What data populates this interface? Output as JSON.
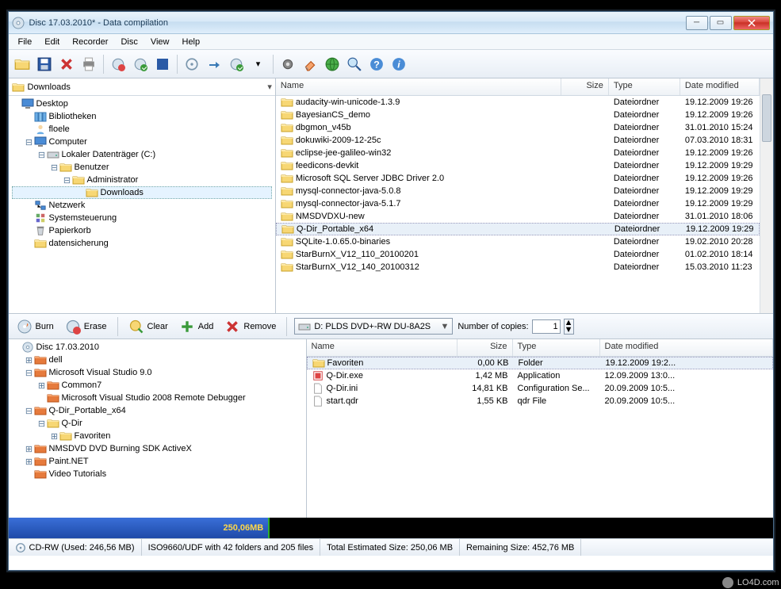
{
  "window": {
    "title": "Disc 17.03.2010* - Data compilation"
  },
  "menu": [
    "File",
    "Edit",
    "Recorder",
    "Disc",
    "View",
    "Help"
  ],
  "breadcrumb": "Downloads",
  "tree_top": [
    {
      "indent": 0,
      "exp": "",
      "icon": "monitor",
      "label": "Desktop"
    },
    {
      "indent": 1,
      "exp": "",
      "icon": "lib",
      "label": "Bibliotheken"
    },
    {
      "indent": 1,
      "exp": "",
      "icon": "user",
      "label": "floele"
    },
    {
      "indent": 1,
      "exp": "-",
      "icon": "computer",
      "label": "Computer"
    },
    {
      "indent": 2,
      "exp": "-",
      "icon": "drive",
      "label": "Lokaler Datenträger (C:)"
    },
    {
      "indent": 3,
      "exp": "-",
      "icon": "folder",
      "label": "Benutzer"
    },
    {
      "indent": 4,
      "exp": "-",
      "icon": "folder",
      "label": "Administrator"
    },
    {
      "indent": 5,
      "exp": "",
      "icon": "folder",
      "label": "Downloads",
      "sel": true
    },
    {
      "indent": 1,
      "exp": "",
      "icon": "network",
      "label": "Netzwerk"
    },
    {
      "indent": 1,
      "exp": "",
      "icon": "control",
      "label": "Systemsteuerung"
    },
    {
      "indent": 1,
      "exp": "",
      "icon": "trash",
      "label": "Papierkorb"
    },
    {
      "indent": 1,
      "exp": "",
      "icon": "folder",
      "label": "datensicherung"
    }
  ],
  "list_top_cols": [
    "Name",
    "Size",
    "Type",
    "Date modified"
  ],
  "list_top": [
    {
      "name": "audacity-win-unicode-1.3.9",
      "size": "",
      "type": "Dateiordner",
      "date": "19.12.2009 19:26"
    },
    {
      "name": "BayesianCS_demo",
      "size": "",
      "type": "Dateiordner",
      "date": "19.12.2009 19:26"
    },
    {
      "name": "dbgmon_v45b",
      "size": "",
      "type": "Dateiordner",
      "date": "31.01.2010 15:24"
    },
    {
      "name": "dokuwiki-2009-12-25c",
      "size": "",
      "type": "Dateiordner",
      "date": "07.03.2010 18:31"
    },
    {
      "name": "eclipse-jee-galileo-win32",
      "size": "",
      "type": "Dateiordner",
      "date": "19.12.2009 19:26"
    },
    {
      "name": "feedicons-devkit",
      "size": "",
      "type": "Dateiordner",
      "date": "19.12.2009 19:29"
    },
    {
      "name": "Microsoft SQL Server JDBC Driver 2.0",
      "size": "",
      "type": "Dateiordner",
      "date": "19.12.2009 19:26"
    },
    {
      "name": "mysql-connector-java-5.0.8",
      "size": "",
      "type": "Dateiordner",
      "date": "19.12.2009 19:29"
    },
    {
      "name": "mysql-connector-java-5.1.7",
      "size": "",
      "type": "Dateiordner",
      "date": "19.12.2009 19:29"
    },
    {
      "name": "NMSDVDXU-new",
      "size": "",
      "type": "Dateiordner",
      "date": "31.01.2010 18:06"
    },
    {
      "name": "Q-Dir_Portable_x64",
      "size": "",
      "type": "Dateiordner",
      "date": "19.12.2009 19:29",
      "sel": true
    },
    {
      "name": "SQLite-1.0.65.0-binaries",
      "size": "",
      "type": "Dateiordner",
      "date": "19.02.2010 20:28"
    },
    {
      "name": "StarBurnX_V12_110_20100201",
      "size": "",
      "type": "Dateiordner",
      "date": "01.02.2010 18:14"
    },
    {
      "name": "StarBurnX_V12_140_20100312",
      "size": "",
      "type": "Dateiordner",
      "date": "15.03.2010 11:23"
    }
  ],
  "actions": {
    "burn": "Burn",
    "erase": "Erase",
    "clear": "Clear",
    "add": "Add",
    "remove": "Remove",
    "device": "D: PLDS DVD+-RW DU-8A2S",
    "copies_label": "Number of copies:",
    "copies_value": "1"
  },
  "tree_bottom": [
    {
      "indent": 0,
      "exp": "",
      "icon": "disc",
      "label": "Disc 17.03.2010"
    },
    {
      "indent": 1,
      "exp": "+",
      "icon": "rfolder",
      "label": "dell"
    },
    {
      "indent": 1,
      "exp": "-",
      "icon": "rfolder",
      "label": "Microsoft Visual Studio 9.0"
    },
    {
      "indent": 2,
      "exp": "+",
      "icon": "rfolder",
      "label": "Common7"
    },
    {
      "indent": 2,
      "exp": "",
      "icon": "rfolder",
      "label": "Microsoft Visual Studio 2008 Remote Debugger"
    },
    {
      "indent": 1,
      "exp": "-",
      "icon": "rfolder",
      "label": "Q-Dir_Portable_x64"
    },
    {
      "indent": 2,
      "exp": "-",
      "icon": "folder",
      "label": "Q-Dir"
    },
    {
      "indent": 3,
      "exp": "+",
      "icon": "folder",
      "label": "Favoriten"
    },
    {
      "indent": 1,
      "exp": "+",
      "icon": "rfolder",
      "label": "NMSDVD DVD Burning SDK ActiveX"
    },
    {
      "indent": 1,
      "exp": "+",
      "icon": "rfolder",
      "label": "Paint.NET"
    },
    {
      "indent": 1,
      "exp": "",
      "icon": "rfolder",
      "label": "Video Tutorials"
    }
  ],
  "list_bottom_cols": [
    "Name",
    "Size",
    "Type",
    "Date modified"
  ],
  "list_bottom": [
    {
      "name": "Favoriten",
      "size": "0,00 KB",
      "type": "Folder",
      "date": "19.12.2009 19:2...",
      "icon": "folder",
      "sel": true
    },
    {
      "name": "Q-Dir.exe",
      "size": "1,42 MB",
      "type": "Application",
      "date": "12.09.2009 13:0...",
      "icon": "exe"
    },
    {
      "name": "Q-Dir.ini",
      "size": "14,81 KB",
      "type": "Configuration Se...",
      "date": "20.09.2009 10:5...",
      "icon": "ini"
    },
    {
      "name": "start.qdr",
      "size": "1,55 KB",
      "type": "qdr File",
      "date": "20.09.2009 10:5...",
      "icon": "file"
    }
  ],
  "progress": {
    "label": "250,06MB"
  },
  "status": {
    "s1": "CD-RW (Used: 246,56 MB)",
    "s2": "ISO9660/UDF with 42 folders and 205 files",
    "s3": "Total Estimated Size: 250,06 MB",
    "s4": "Remaining Size: 452,76 MB"
  },
  "brand": "LO4D.com"
}
